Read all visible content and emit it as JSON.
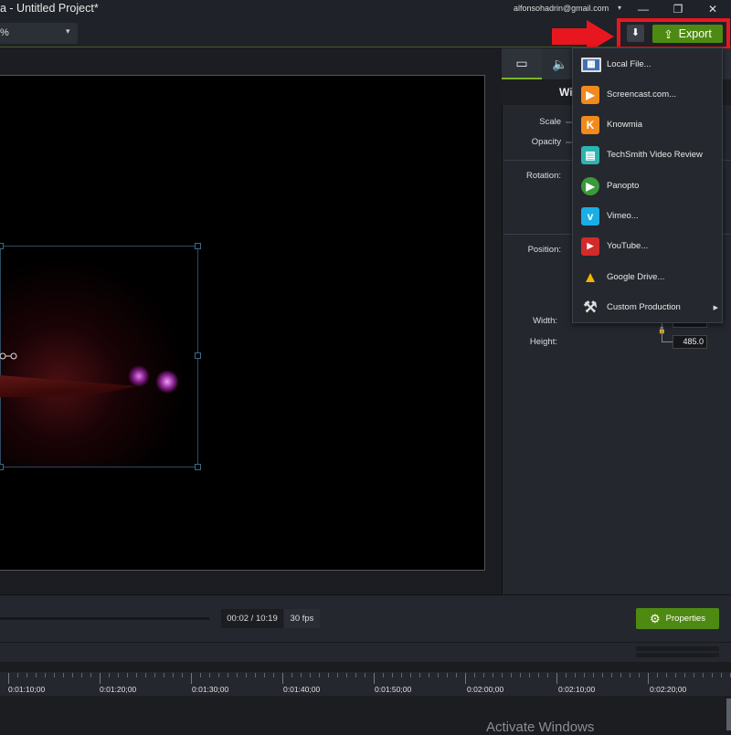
{
  "window": {
    "title": "a - Untitled Project*",
    "account": "alfonsohadrin@gmail.com",
    "account_caret": "▾",
    "minimize": "—",
    "restore": "❐",
    "close": "✕"
  },
  "toolbar": {
    "zoom_value": "%",
    "zoom_caret": "▾",
    "download_icon": "⬇",
    "export_label": "Export",
    "export_icon": "⇪"
  },
  "colors": {
    "accent_green": "#4e8a12",
    "highlight_red": "#e8171f",
    "tab_active": "#7bb424"
  },
  "side_panel": {
    "tabs": [
      {
        "name": "visual-properties",
        "icon": "film-icon",
        "glyph": "▭"
      },
      {
        "name": "audio-properties",
        "icon": "speaker-icon",
        "glyph": "🔈"
      }
    ],
    "header": "Wi",
    "labels": {
      "scale": "Scale",
      "opacity": "Opacity",
      "rotation": "Rotation:",
      "position": "Position:",
      "width": "Width:",
      "height": "Height:"
    },
    "height_value": "485.0",
    "lock_icon": "🔓"
  },
  "export_menu": {
    "items": [
      {
        "label": "Local File...",
        "icon": "film-icon",
        "glyph": "▦",
        "color": "#3f6fb5"
      },
      {
        "label": "Screencast.com...",
        "icon": "screencast-icon",
        "glyph": "▶",
        "color": "#f08a1c"
      },
      {
        "label": "Knowmia",
        "icon": "knowmia-icon",
        "glyph": "K",
        "color": "#f08a1c"
      },
      {
        "label": "TechSmith Video Review",
        "icon": "video-review-icon",
        "glyph": "▤",
        "color": "#2fb3b0"
      },
      {
        "label": "Panopto",
        "icon": "panopto-icon",
        "glyph": "▶",
        "color": "#3a9a3a"
      },
      {
        "label": "Vimeo...",
        "icon": "vimeo-icon",
        "glyph": "v",
        "color": "#1aaee6"
      },
      {
        "label": "YouTube...",
        "icon": "youtube-icon",
        "glyph": "▶",
        "color": "#d42a2a"
      },
      {
        "label": "Google Drive...",
        "icon": "google-drive-icon",
        "glyph": "▲",
        "color": "#1a9a4a"
      },
      {
        "label": "Custom Production",
        "icon": "tools-icon",
        "glyph": "⚒",
        "color": "transparent",
        "has_submenu": true
      }
    ],
    "submenu_caret": "▶"
  },
  "transport": {
    "time": "00:02 / 10:19",
    "fps": "30 fps",
    "properties_label": "Properties",
    "properties_icon": "⚙"
  },
  "timeline": {
    "ruler_labels": [
      "0:01:10;00",
      "0:01:20;00",
      "0:01:30;00",
      "0:01:40;00",
      "0:01:50;00",
      "0:02:00;00",
      "0:02:10;00",
      "0:02:20;00"
    ]
  },
  "watermark": "Activate Windows"
}
